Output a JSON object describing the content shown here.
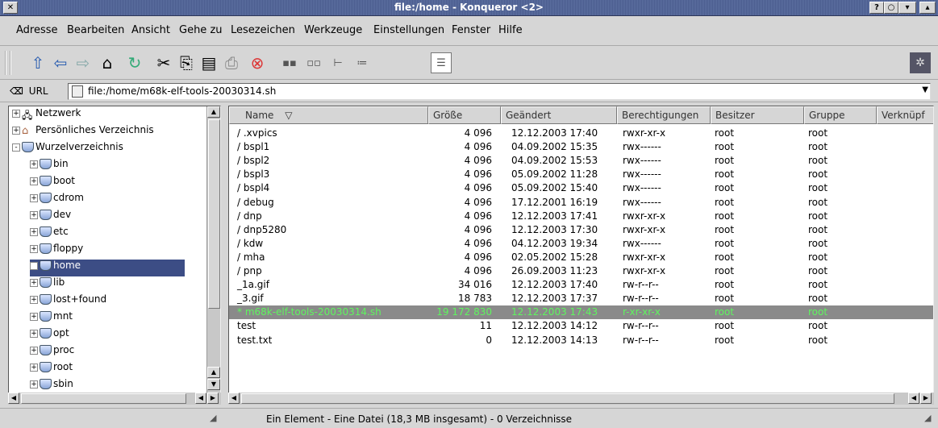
{
  "window": {
    "title": "file:/home - Konqueror <2>",
    "buttons": [
      "?",
      "○",
      "▾",
      "▴"
    ]
  },
  "menu": [
    "Adresse",
    "Bearbeiten",
    "Ansicht",
    "Gehe zu",
    "Lesezeichen",
    "Werkzeuge",
    "Einstellungen",
    "Fenster",
    "Hilfe"
  ],
  "location": {
    "label": "URL",
    "value": "file:/home/m68k-elf-tools-20030314.sh"
  },
  "tree": [
    {
      "label": "Netzwerk",
      "level": 0,
      "icon": "network-icon",
      "expander": "+"
    },
    {
      "label": "Persönliches Verzeichnis",
      "level": 0,
      "icon": "home-icon",
      "expander": "+"
    },
    {
      "label": "Wurzelverzeichnis",
      "level": 0,
      "icon": "disk-icon",
      "expander": "-"
    },
    {
      "label": "bin",
      "level": 1,
      "icon": "folder-icon",
      "expander": "+"
    },
    {
      "label": "boot",
      "level": 1,
      "icon": "folder-icon",
      "expander": "+"
    },
    {
      "label": "cdrom",
      "level": 1,
      "icon": "folder-icon",
      "expander": "+"
    },
    {
      "label": "dev",
      "level": 1,
      "icon": "folder-icon",
      "expander": "+"
    },
    {
      "label": "etc",
      "level": 1,
      "icon": "folder-icon",
      "expander": "+"
    },
    {
      "label": "floppy",
      "level": 1,
      "icon": "folder-icon",
      "expander": "+"
    },
    {
      "label": "home",
      "level": 1,
      "icon": "folder-icon",
      "expander": "+",
      "selected": true
    },
    {
      "label": "lib",
      "level": 1,
      "icon": "folder-icon",
      "expander": "+"
    },
    {
      "label": "lost+found",
      "level": 1,
      "icon": "folder-icon",
      "expander": "+"
    },
    {
      "label": "mnt",
      "level": 1,
      "icon": "folder-icon",
      "expander": "+"
    },
    {
      "label": "opt",
      "level": 1,
      "icon": "folder-icon",
      "expander": "+"
    },
    {
      "label": "proc",
      "level": 1,
      "icon": "folder-icon",
      "expander": "+"
    },
    {
      "label": "root",
      "level": 1,
      "icon": "folder-icon",
      "expander": "+"
    },
    {
      "label": "sbin",
      "level": 1,
      "icon": "folder-icon",
      "expander": "+"
    }
  ],
  "columns": [
    "Name",
    "Größe",
    "Geändert",
    "Berechtigungen",
    "Besitzer",
    "Gruppe",
    "Verknüpf"
  ],
  "files": [
    {
      "name": "/ .xvpics",
      "size": "4 096",
      "modified": "12.12.2003 17:40",
      "perms": "rwxr-xr-x",
      "owner": "root",
      "group": "root"
    },
    {
      "name": "/ bspl1",
      "size": "4 096",
      "modified": "04.09.2002 15:35",
      "perms": "rwx------",
      "owner": "root",
      "group": "root"
    },
    {
      "name": "/ bspl2",
      "size": "4 096",
      "modified": "04.09.2002 15:53",
      "perms": "rwx------",
      "owner": "root",
      "group": "root"
    },
    {
      "name": "/ bspl3",
      "size": "4 096",
      "modified": "05.09.2002 11:28",
      "perms": "rwx------",
      "owner": "root",
      "group": "root"
    },
    {
      "name": "/ bspl4",
      "size": "4 096",
      "modified": "05.09.2002 15:40",
      "perms": "rwx------",
      "owner": "root",
      "group": "root"
    },
    {
      "name": "/ debug",
      "size": "4 096",
      "modified": "17.12.2001 16:19",
      "perms": "rwx------",
      "owner": "root",
      "group": "root"
    },
    {
      "name": "/ dnp",
      "size": "4 096",
      "modified": "12.12.2003 17:41",
      "perms": "rwxr-xr-x",
      "owner": "root",
      "group": "root"
    },
    {
      "name": "/ dnp5280",
      "size": "4 096",
      "modified": "12.12.2003 17:30",
      "perms": "rwxr-xr-x",
      "owner": "root",
      "group": "root"
    },
    {
      "name": "/ kdw",
      "size": "4 096",
      "modified": "04.12.2003 19:34",
      "perms": "rwx------",
      "owner": "root",
      "group": "root"
    },
    {
      "name": "/ mha",
      "size": "4 096",
      "modified": "02.05.2002 15:28",
      "perms": "rwxr-xr-x",
      "owner": "root",
      "group": "root"
    },
    {
      "name": "/ pnp",
      "size": "4 096",
      "modified": "26.09.2003 11:23",
      "perms": "rwxr-xr-x",
      "owner": "root",
      "group": "root"
    },
    {
      "name": "_1a.gif",
      "size": "34 016",
      "modified": "12.12.2003 17:40",
      "perms": "rw-r--r--",
      "owner": "root",
      "group": "root"
    },
    {
      "name": "_3.gif",
      "size": "18 783",
      "modified": "12.12.2003 17:37",
      "perms": "rw-r--r--",
      "owner": "root",
      "group": "root"
    },
    {
      "name": "* m68k-elf-tools-20030314.sh",
      "size": "19 172 830",
      "modified": "12.12.2003 17:43",
      "perms": "r-xr-xr-x",
      "owner": "root",
      "group": "root",
      "selected": true
    },
    {
      "name": "test",
      "size": "11",
      "modified": "12.12.2003 14:12",
      "perms": "rw-r--r--",
      "owner": "root",
      "group": "root"
    },
    {
      "name": "test.txt",
      "size": "0",
      "modified": "12.12.2003 14:13",
      "perms": "rw-r--r--",
      "owner": "root",
      "group": "root"
    }
  ],
  "status": "Ein Element - Eine Datei (18,3 MB insgesamt) - 0 Verzeichnisse",
  "colors": {
    "title_bg": "#4a5c8e",
    "tree_selected": "#3c4d85",
    "row_selected_bg": "#8a8a8a",
    "row_selected_text": "#5ef65e"
  }
}
